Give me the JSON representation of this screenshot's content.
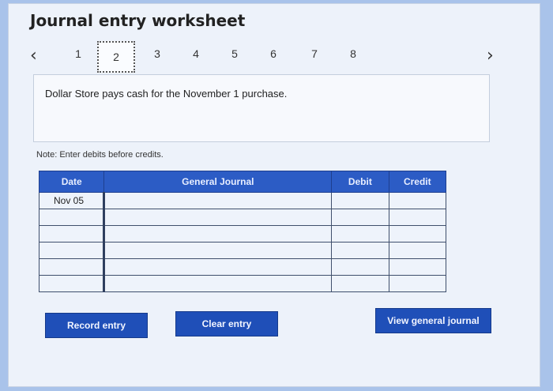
{
  "header": {
    "title": "Journal entry worksheet"
  },
  "pager": {
    "prev_icon": "chevron-left-icon",
    "next_icon": "chevron-right-icon",
    "pages": [
      "1",
      "2",
      "3",
      "4",
      "5",
      "6",
      "7",
      "8"
    ],
    "active_page": "2"
  },
  "task": {
    "prompt": "Dollar Store pays cash for the November 1 purchase."
  },
  "note": "Note: Enter debits before credits.",
  "journal": {
    "columns": [
      "Date",
      "General Journal",
      "Debit",
      "Credit"
    ],
    "rows": [
      {
        "date": "Nov 05",
        "account": "",
        "debit": "",
        "credit": ""
      },
      {
        "date": "",
        "account": "",
        "debit": "",
        "credit": ""
      },
      {
        "date": "",
        "account": "",
        "debit": "",
        "credit": ""
      },
      {
        "date": "",
        "account": "",
        "debit": "",
        "credit": ""
      },
      {
        "date": "",
        "account": "",
        "debit": "",
        "credit": ""
      },
      {
        "date": "",
        "account": "",
        "debit": "",
        "credit": ""
      }
    ]
  },
  "buttons": {
    "record": "Record entry",
    "clear": "Clear entry",
    "view": "View general journal"
  },
  "colors": {
    "header_blue": "#2c5cc5",
    "button_blue": "#1f4fb8"
  }
}
